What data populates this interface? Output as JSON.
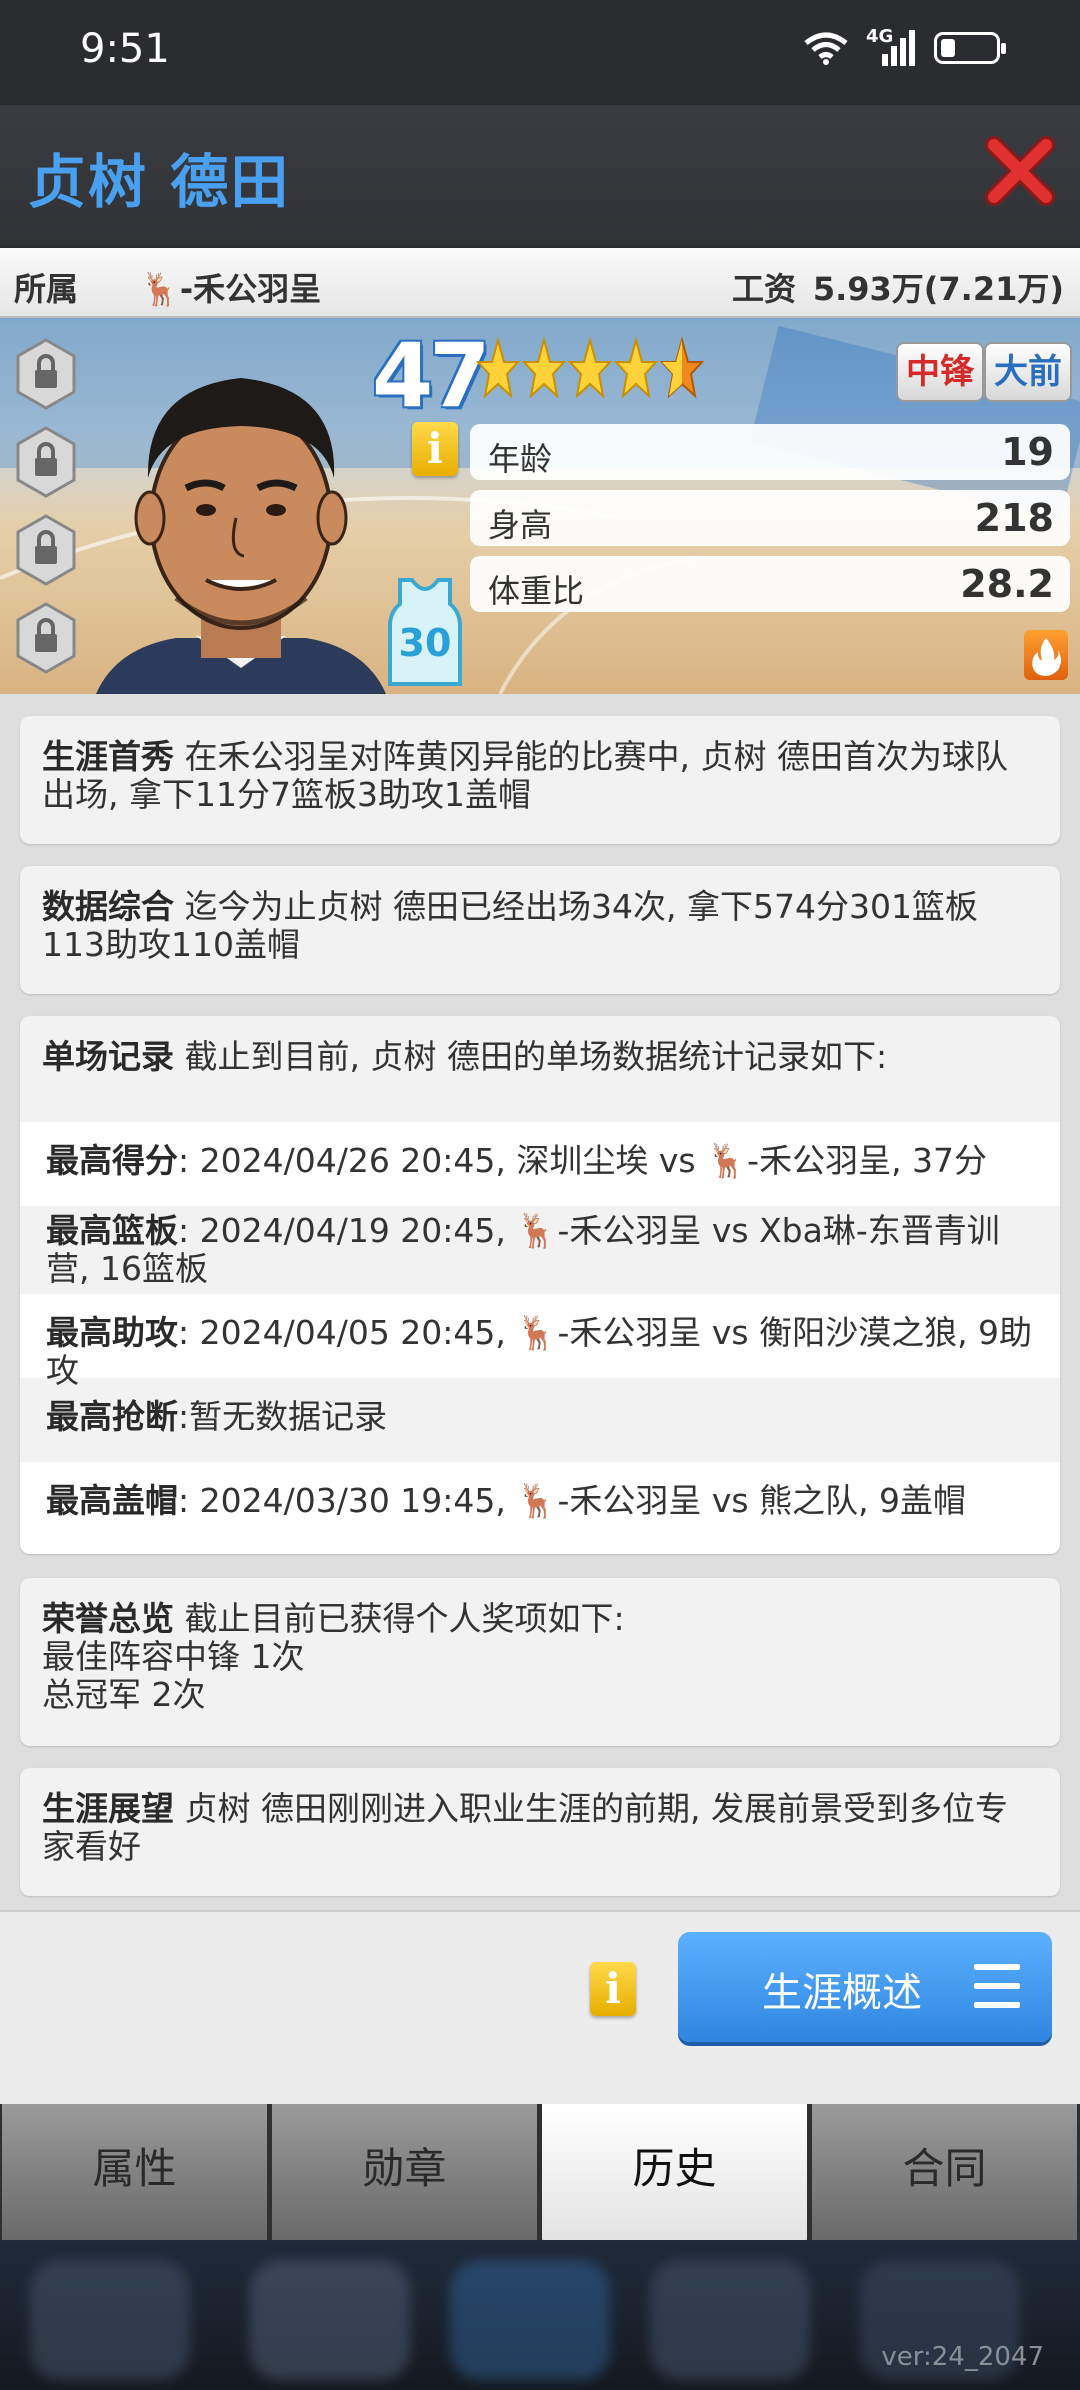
{
  "status_bar": {
    "time": "9:51",
    "network": "4G"
  },
  "header": {
    "player_name": "贞树 德田"
  },
  "info_bar": {
    "team_label": "所属",
    "team": "🦌-禾公羽呈",
    "salary_label": "工资",
    "salary": "5.93万(7.21万)"
  },
  "player_card": {
    "overall": "47",
    "star_rating": 4.5,
    "positions": [
      "中锋",
      "大前"
    ],
    "jersey_number": "30",
    "stats": [
      {
        "label": "年龄",
        "value": "19"
      },
      {
        "label": "身高",
        "value": "218"
      },
      {
        "label": "体重比",
        "value": "28.2"
      }
    ],
    "locked_slots": 4,
    "info_icon": "i"
  },
  "history": {
    "debut": {
      "title": "生涯首秀",
      "text": "在禾公羽呈对阵黄冈异能的比赛中, 贞树 德田首次为球队出场, 拿下11分7篮板3助攻1盖帽"
    },
    "summary": {
      "title": "数据综合",
      "text": "迄今为止贞树 德田已经出场34次, 拿下574分301篮板113助攻110盖帽"
    },
    "records": {
      "title": "单场记录",
      "text": "截止到目前, 贞树 德田的单场数据统计记录如下:",
      "items": [
        {
          "label": "最高得分",
          "text": ": 2024/04/26 20:45, 深圳尘埃 vs 🦌-禾公羽呈, 37分"
        },
        {
          "label": "最高篮板",
          "text": ": 2024/04/19 20:45, 🦌-禾公羽呈 vs Xba琳-东晋青训营, 16篮板"
        },
        {
          "label": "最高助攻",
          "text": ": 2024/04/05 20:45, 🦌-禾公羽呈 vs 衡阳沙漠之狼, 9助攻"
        },
        {
          "label": "最高抢断",
          "text": ":暂无数据记录"
        },
        {
          "label": "最高盖帽",
          "text": ": 2024/03/30 19:45, 🦌-禾公羽呈 vs 熊之队, 9盖帽"
        }
      ]
    },
    "honors": {
      "title": "荣誉总览",
      "text": "截止目前已获得个人奖项如下:",
      "lines": [
        "最佳阵容中锋  1次",
        "总冠军  2次"
      ]
    },
    "outlook": {
      "title": "生涯展望",
      "text": "贞树 德田刚刚进入职业生涯的前期, 发展前景受到多位专家看好"
    }
  },
  "footer": {
    "info_icon": "i",
    "career_button": "生涯概述"
  },
  "tabs": [
    {
      "label": "属性",
      "active": false
    },
    {
      "label": "勋章",
      "active": false
    },
    {
      "label": "历史",
      "active": true
    },
    {
      "label": "合同",
      "active": false
    }
  ],
  "version": "ver:24_2047",
  "colors": {
    "name_blue": "#4aa0f0",
    "close_red": "#e03030",
    "button_blue": "#3d97f0",
    "position_red": "#d42a2a",
    "position_blue": "#2a6fbf"
  }
}
